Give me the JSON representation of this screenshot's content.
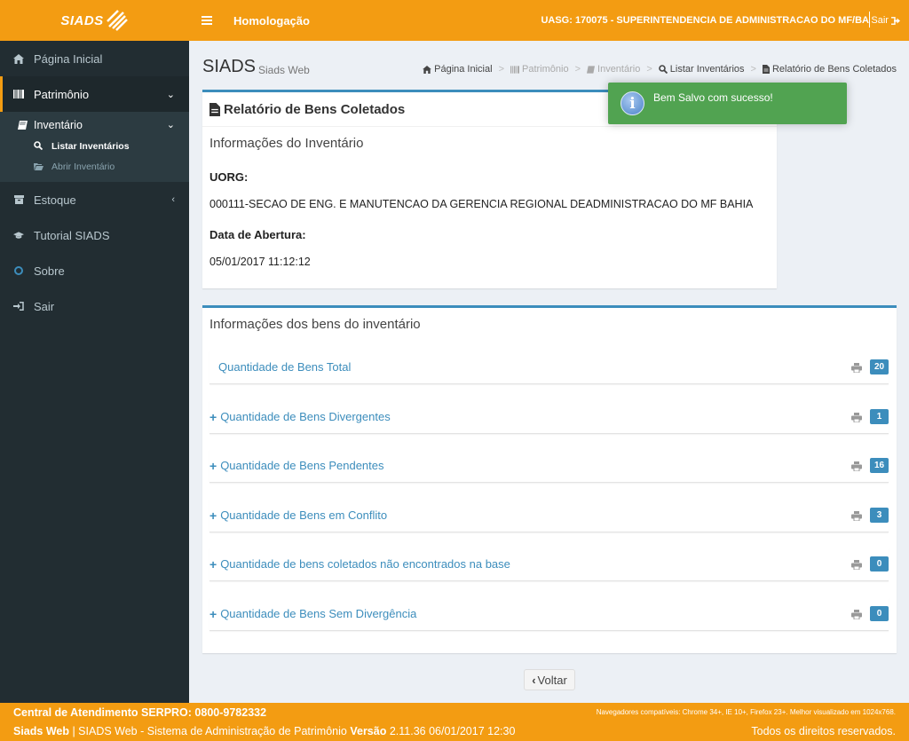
{
  "brand": {
    "logo_text": "SIADS"
  },
  "header": {
    "env": "Homologação",
    "uasg": "UASG: 170075 - SUPERINTENDENCIA DE ADMINISTRACAO DO MF/BA",
    "logout": "Sair"
  },
  "sidebar": {
    "items": [
      {
        "label": "Página Inicial",
        "icon": "home-icon"
      },
      {
        "label": "Patrimônio",
        "icon": "barcode-icon"
      },
      {
        "label": "Inventário",
        "icon": "book-icon"
      },
      {
        "label": "Listar Inventários",
        "icon": "search-icon"
      },
      {
        "label": "Abrir Inventário",
        "icon": "folder-open-icon"
      },
      {
        "label": "Estoque",
        "icon": "archive-icon"
      },
      {
        "label": "Tutorial SIADS",
        "icon": "graduation-cap-icon"
      },
      {
        "label": "Sobre",
        "icon": "circle-icon"
      },
      {
        "label": "Sair",
        "icon": "sign-in-icon"
      }
    ]
  },
  "page": {
    "title": "SIADS",
    "subtitle": "Siads Web"
  },
  "breadcrumb": [
    {
      "label": "Página Inicial"
    },
    {
      "label": "Patrimônio"
    },
    {
      "label": "Inventário"
    },
    {
      "label": "Listar Inventários"
    },
    {
      "label": "Relatório de Bens Coletados"
    }
  ],
  "report": {
    "title": "Relatório de Bens Coletados",
    "info_title": "Informações do Inventário",
    "uorg_label": "UORG:",
    "uorg_value": "000111-SECAO DE ENG. E MANUTENCAO DA GERENCIA REGIONAL DEADMINISTRACAO DO MF BAHIA",
    "date_label": "Data de Abertura:",
    "date_value": "05/01/2017 11:12:12"
  },
  "toast": {
    "message": "Bem Salvo com sucesso!"
  },
  "goods": {
    "title": "Informações dos bens do inventário",
    "rows": [
      {
        "label": "Quantidade de Bens Total",
        "count": "20",
        "expandable": false
      },
      {
        "label": "Quantidade de Bens Divergentes",
        "count": "1",
        "expandable": true
      },
      {
        "label": "Quantidade de Bens Pendentes",
        "count": "16",
        "expandable": true
      },
      {
        "label": "Quantidade de Bens em Conflito",
        "count": "3",
        "expandable": true
      },
      {
        "label": "Quantidade de bens coletados não encontrados na base",
        "count": "0",
        "expandable": true
      },
      {
        "label": "Quantidade de Bens Sem Divergência",
        "count": "0",
        "expandable": true
      }
    ]
  },
  "back_button": "Voltar",
  "footer": {
    "support": "Central de Atendimento SERPRO: 0800-9782332",
    "browsers": "Navegadores compatíveis: Chrome 34+, IE 10+, Firefox 23+. Melhor visualizado em 1024x768.",
    "app_name": "Siads Web",
    "app_desc": " | SIADS Web - Sistema de Administração de Patrimônio ",
    "version_label": "Versão",
    "version_value": " 2.11.36 06/01/2017 12:30",
    "rights": "Todos os direitos reservados."
  },
  "colors": {
    "accent": "#f39c12",
    "sidebar": "#222d32",
    "primary": "#3c8dbc",
    "success": "#51a351"
  }
}
